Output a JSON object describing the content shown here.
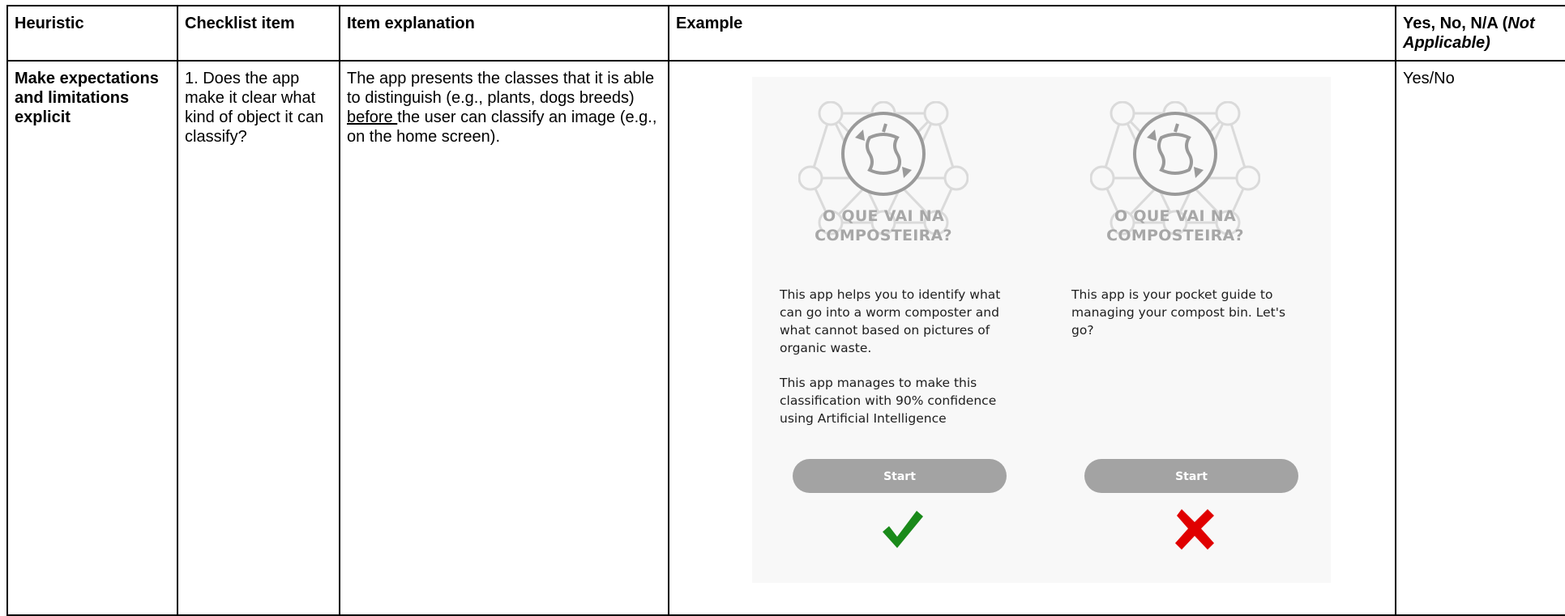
{
  "headers": {
    "heuristic": "Heuristic",
    "checklist": "Checklist item",
    "explanation": "Item explanation",
    "example": "Example",
    "answer_prefix": "Yes, No,  N/A (",
    "answer_italic": "Not Applicable)"
  },
  "row": {
    "heuristic": "Make expectations and limitations explicit",
    "checklist": "1. Does the app make it clear what kind of object it can classify?",
    "explanation_before": "The app presents the classes that it is able to distinguish (e.g., plants, dogs breeds) ",
    "explanation_underlined": "before ",
    "explanation_after": "the user can classify an image (e.g., on the home screen).",
    "answer": "Yes/No"
  },
  "example": {
    "logo_line1": "O QUE VAI NA",
    "logo_line2": "COMPOSTEIRA?",
    "good": {
      "text1": "This app helps you to identify what can go into a worm composter and what cannot based on pictures of organic waste.",
      "text2": "This app manages to make this classification with 90% confidence using Artificial Intelligence",
      "button": "Start",
      "verdict_icon": "check-icon",
      "verdict_color": "#1a8a1a"
    },
    "bad": {
      "text1": "This app is your pocket guide to managing your compost bin. Let's go?",
      "button": "Start",
      "verdict_icon": "cross-icon",
      "verdict_color": "#e00000"
    },
    "panel_color": "#f8f8f8",
    "button_color": "#a3a3a3"
  }
}
